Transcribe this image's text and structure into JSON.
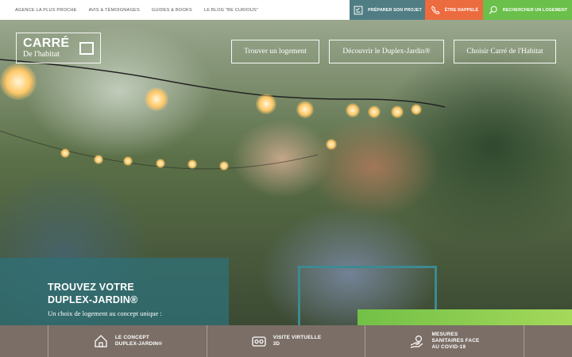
{
  "topbar": {
    "links": [
      "AGENCE LA PLUS PROCHE",
      "AVIS & TÉMOIGNAGES",
      "GUIDES & BOOKS",
      "LE BLOG \"BE CURIOUS\""
    ],
    "cta": {
      "projet": "PRÉPARER SON PROJET",
      "rappel": "ÊTRE RAPPELÉ",
      "logement": "RECHERCHER UN LOGEMENT"
    },
    "colors": {
      "projet": "#4f7d83",
      "rappel": "#ec6b3f",
      "logement": "#6bbf4b"
    }
  },
  "logo": {
    "main": "CARRÉ",
    "sub": "De l'habitat"
  },
  "nav": [
    "Trouver un logement",
    "Découvrir le Duplex-Jardin®",
    "Choisir Carré de l'Habitat"
  ],
  "hero": {
    "headline_line1": "TROUVEZ VOTRE",
    "headline_line2": "DUPLEX-JARDIN®",
    "subline": "Un choix de logement au concept unique :"
  },
  "bottombar": {
    "items": [
      {
        "icon": "house-icon",
        "line1": "LE CONCEPT",
        "line2": "DUPLEX-JARDIN®"
      },
      {
        "icon": "virtual-tour-icon",
        "line1": "VISITE VIRTUELLE",
        "line2": "3D"
      },
      {
        "icon": "covid-hands-icon",
        "line1": "MESURES",
        "line2": "SANITAIRES FACE",
        "line3": "AU COVID-19"
      }
    ],
    "color": "#7a6e66"
  }
}
